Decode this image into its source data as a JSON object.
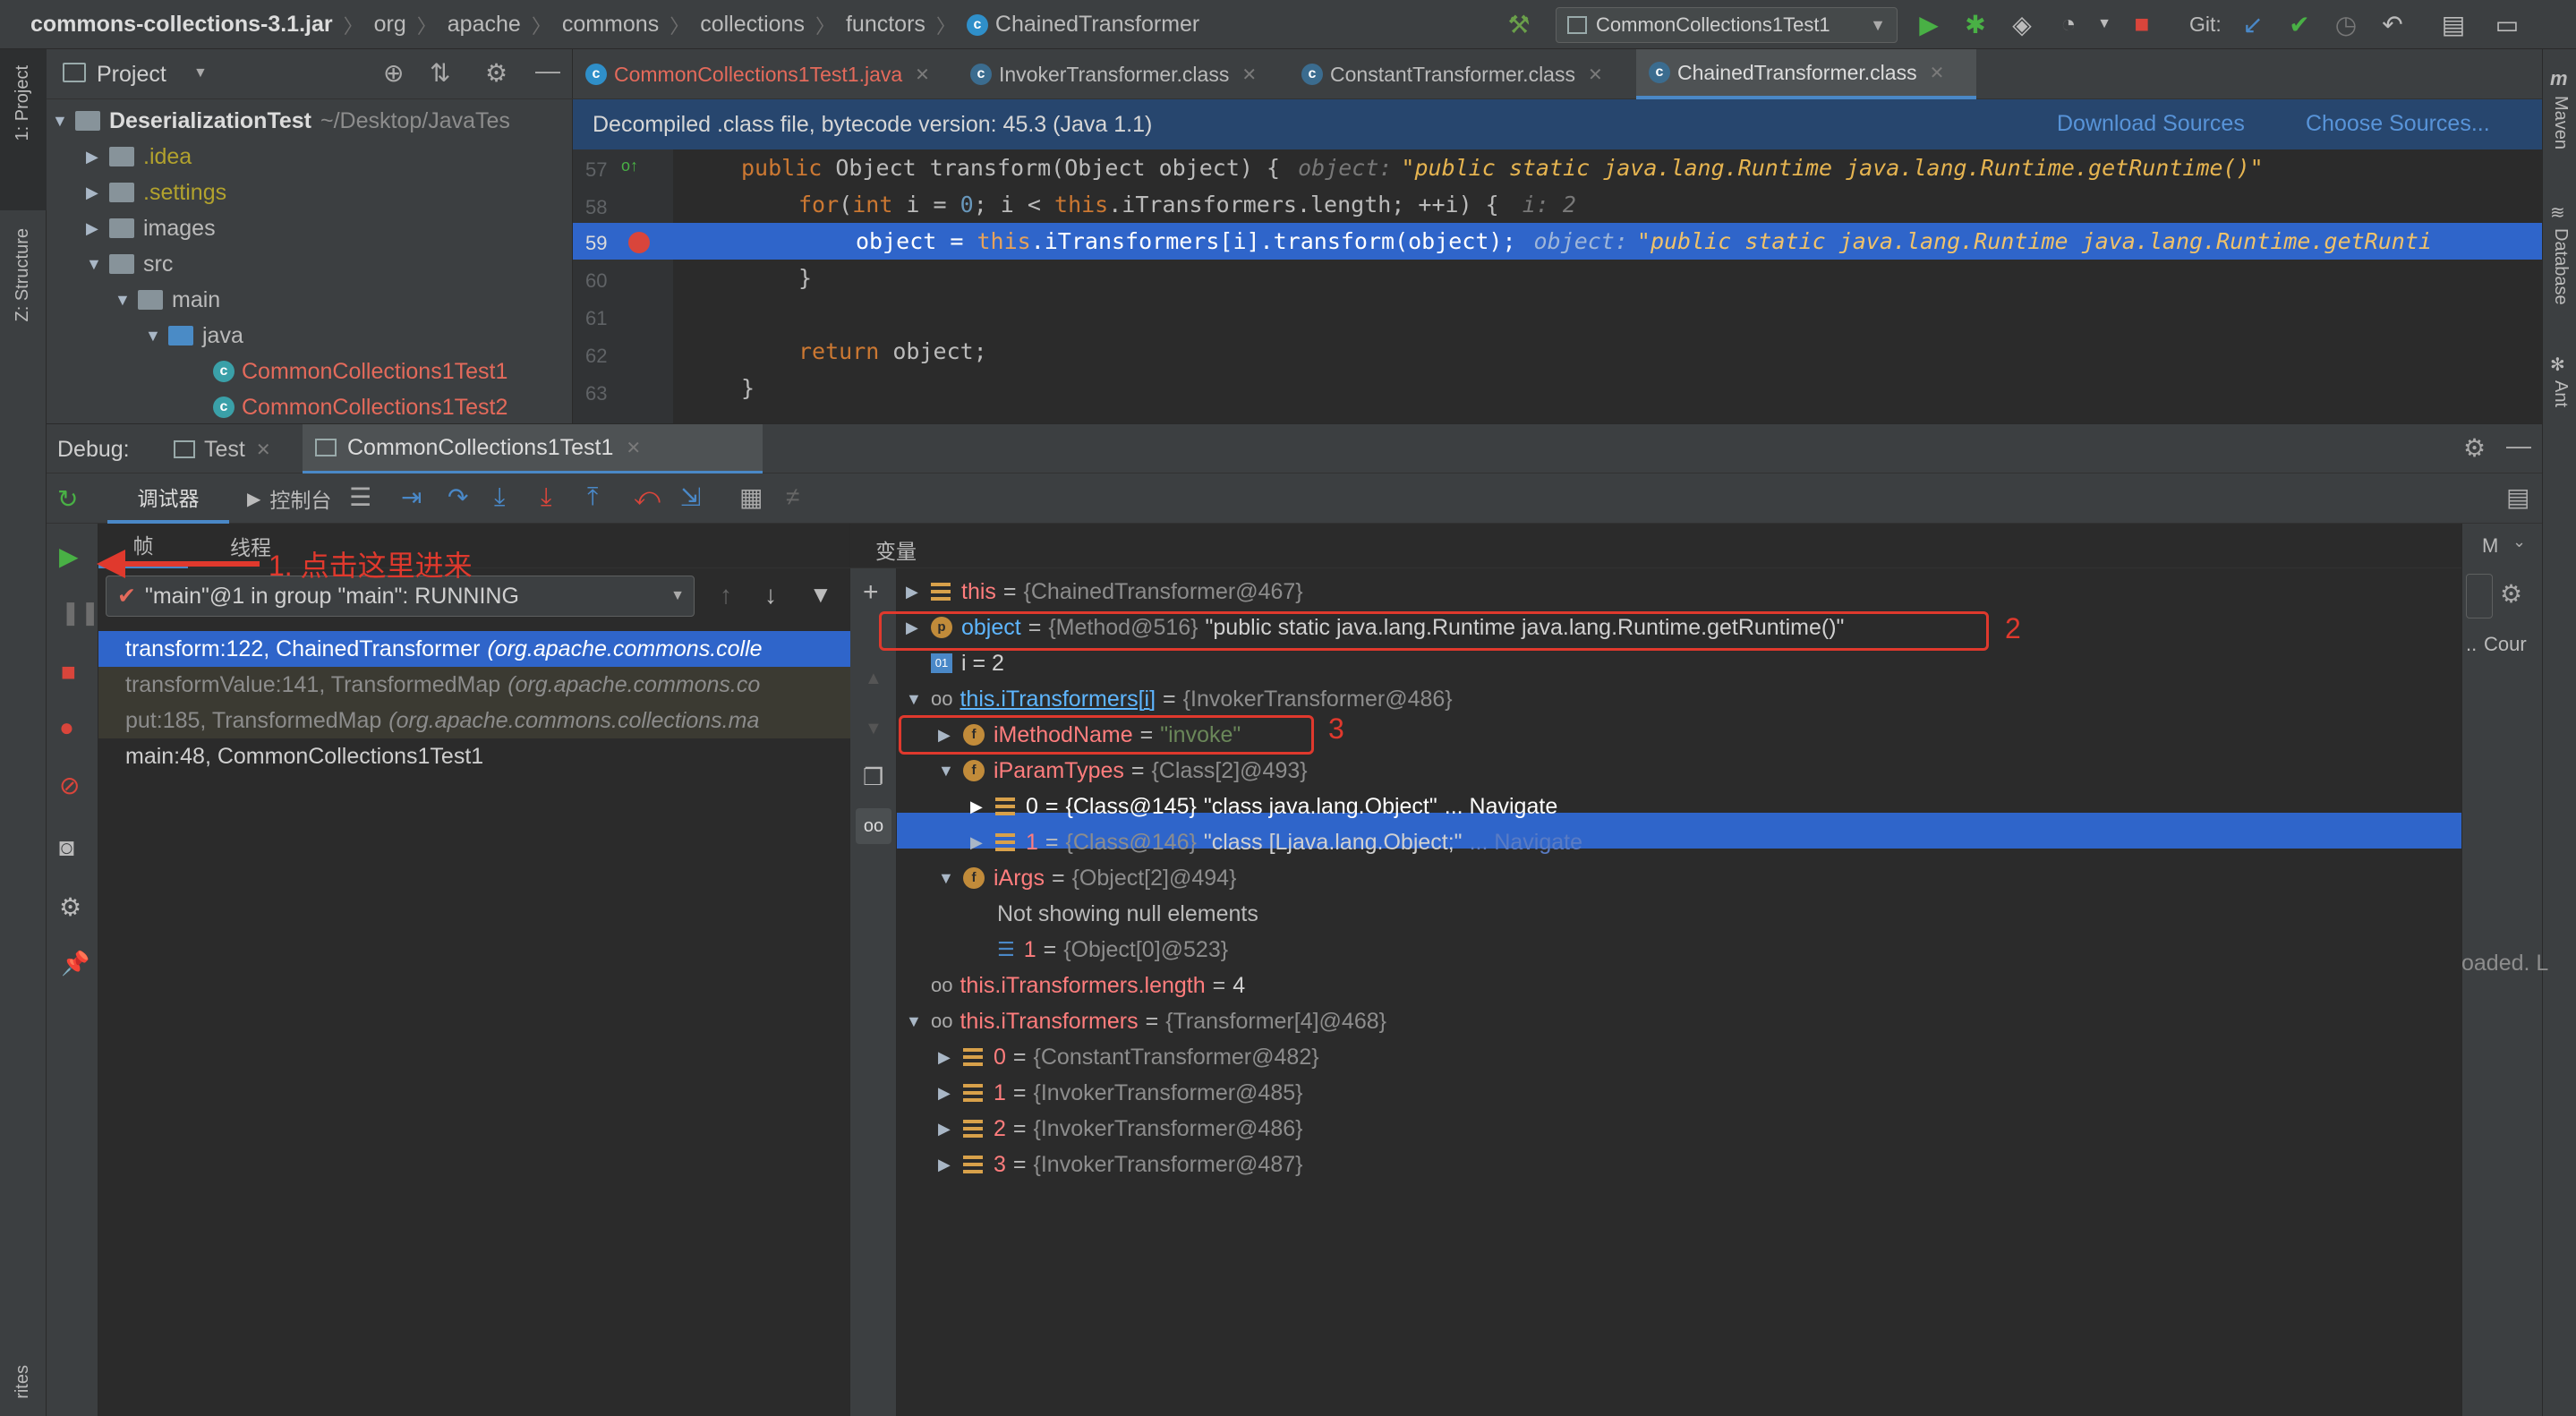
{
  "breadcrumb": [
    "commons-collections-3.1.jar",
    "org",
    "apache",
    "commons",
    "collections",
    "functors",
    "ChainedTransformer"
  ],
  "run_config": "CommonCollections1Test1",
  "git_label": "Git:",
  "project": {
    "title": "Project",
    "root": "DeserializationTest",
    "root_path": "~/Desktop/JavaTes",
    "items": [
      ".idea",
      ".settings",
      "images",
      "src",
      "main",
      "java",
      "CommonCollections1Test1",
      "CommonCollections1Test2"
    ]
  },
  "left_stripe": {
    "project": "1: Project",
    "structure": "Z: Structure",
    "favorites": "rites"
  },
  "right_stripe": {
    "maven": "Maven",
    "database": "Database",
    "ant": "Ant"
  },
  "editor_tabs": [
    "CommonCollections1Test1.java",
    "InvokerTransformer.class",
    "ConstantTransformer.class",
    "ChainedTransformer.class"
  ],
  "banner": {
    "text": "Decompiled .class file, bytecode version: 45.3 (Java 1.1)",
    "download": "Download Sources",
    "choose": "Choose Sources..."
  },
  "code": {
    "line_numbers": [
      "57",
      "58",
      "59",
      "60",
      "61",
      "62",
      "63"
    ],
    "l57_kw1": "public",
    "l57_rest": " Object transform(Object object) {",
    "l57_hint_label": "object:",
    "l57_hint_val": "\"public static java.lang.Runtime java.lang.Runtime.getRuntime()\"",
    "l58_kw": "for",
    "l58_a": "(",
    "l58_int": "int",
    "l58_b": " i = ",
    "l58_zero": "0",
    "l58_c": "; i < ",
    "l58_this": "this",
    "l58_d": ".iTransformers.length; ++i) {",
    "l58_hint": "i: 2",
    "l59_a": "object = ",
    "l59_this": "this",
    "l59_b": ".iTransformers[i].transform(object);",
    "l59_hint_label": "object:",
    "l59_hint_val": "\"public static java.lang.Runtime java.lang.Runtime.getRunti",
    "l60": "}",
    "l62_kw": "return",
    "l62_rest": " object;",
    "l63": "}"
  },
  "debug": {
    "label": "Debug:",
    "tabs": [
      "Test",
      "CommonCollections1Test1"
    ],
    "tb_debugger": "调试器",
    "tb_console": "控制台",
    "frames_tab": "帧",
    "threads_tab": "线程",
    "thread_select": "\"main\"@1 in group \"main\": RUNNING",
    "frames": [
      {
        "method": "transform:122, ChainedTransformer",
        "pkg": "(org.apache.commons.colle"
      },
      {
        "method": "transformValue:141, TransformedMap",
        "pkg": "(org.apache.commons.co"
      },
      {
        "method": "put:185, TransformedMap",
        "pkg": "(org.apache.commons.collections.ma"
      },
      {
        "method": "main:48, CommonCollections1Test1",
        "pkg": ""
      }
    ],
    "variables_title": "变量",
    "vars": {
      "this_name": "this",
      "this_type": "{ChainedTransformer@467}",
      "object_name": "object",
      "object_type": "{Method@516}",
      "object_val": "\"public static java.lang.Runtime java.lang.Runtime.getRuntime()\"",
      "i_text": "i = 2",
      "cur_name": "this.iTransformers[i]",
      "cur_type": "{InvokerTransformer@486}",
      "mname_name": "iMethodName",
      "mname_val": "\"invoke\"",
      "ptypes_name": "iParamTypes",
      "ptypes_type": "{Class[2]@493}",
      "p0_name": "0",
      "p0_type": "{Class@145}",
      "p0_val": "\"class java.lang.Object\"",
      "p0_nav": "... Navigate",
      "p1_name": "1",
      "p1_type": "{Class@146}",
      "p1_val": "\"class [Ljava.lang.Object;\"",
      "p1_nav": "... Navigate",
      "iargs_name": "iArgs",
      "iargs_type": "{Object[2]@494}",
      "null_note": "Not showing null elements",
      "a1_name": "1",
      "a1_type": "{Object[0]@523}",
      "len_name": "this.iTransformers.length",
      "len_val": "4",
      "arr_name": "this.iTransformers",
      "arr_type": "{Transformer[4]@468}",
      "t0_name": "0",
      "t0_type": "{ConstantTransformer@482}",
      "t1_name": "1",
      "t1_type": "{InvokerTransformer@485}",
      "t2_name": "2",
      "t2_type": "{InvokerTransformer@486}",
      "t3_name": "3",
      "t3_type": "{InvokerTransformer@487}"
    },
    "watches_m": "M",
    "watches_cour": "Cour",
    "loaded_text": "oaded. L"
  },
  "annotations": {
    "a1": "1. 点击这里进来",
    "a2": "2",
    "a3": "3"
  },
  "colors": {
    "accent": "#2f65ca",
    "annotation": "#e0392d",
    "string": "#6a8759",
    "keyword": "#cc7832"
  }
}
